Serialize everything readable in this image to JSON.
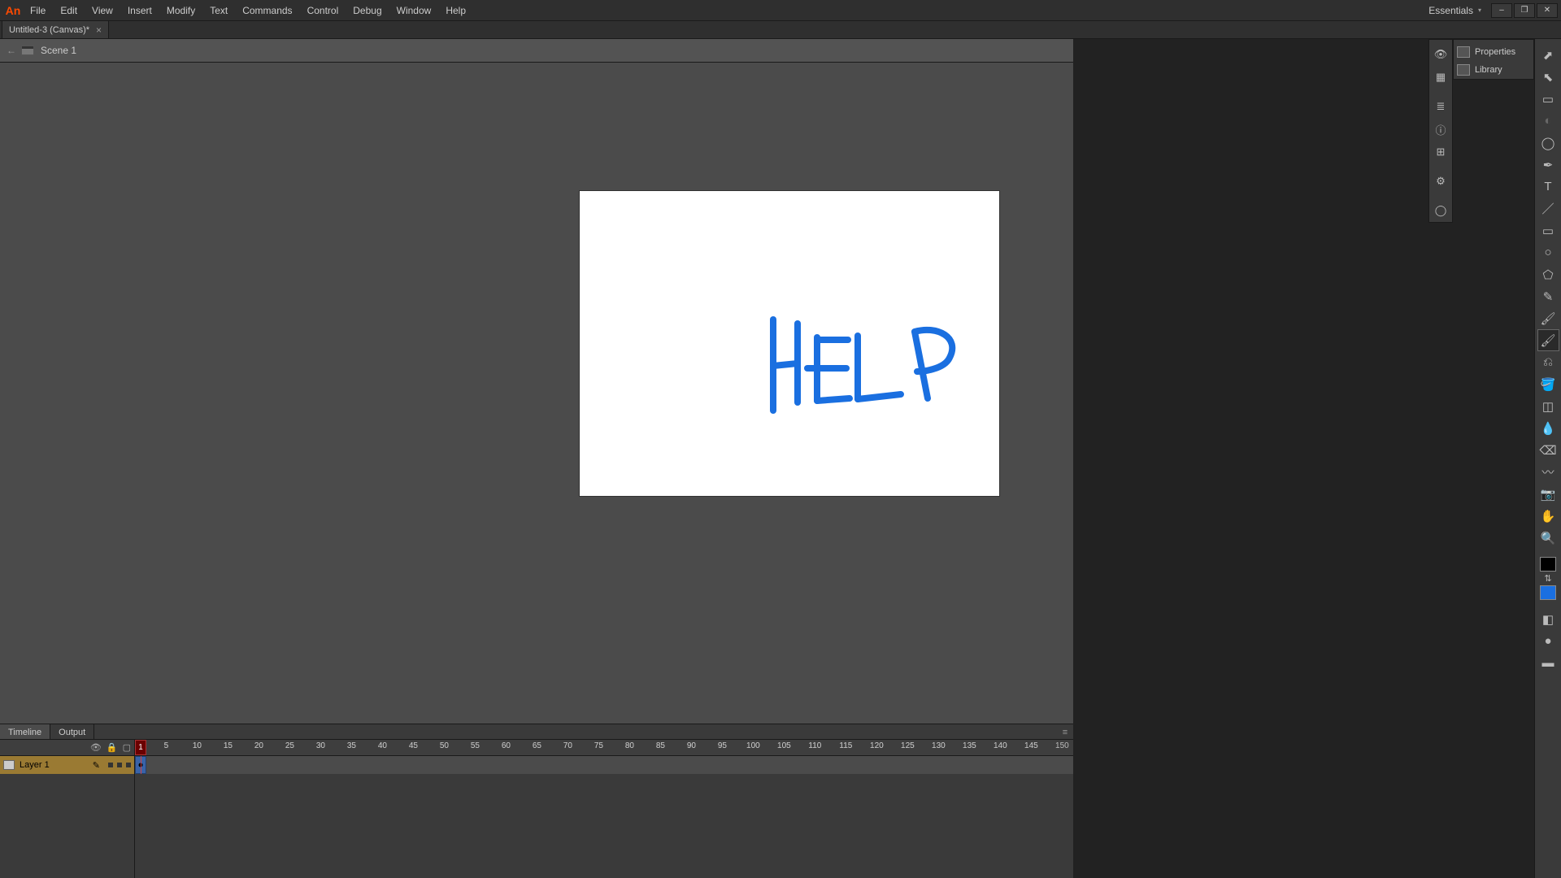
{
  "app": {
    "logo": "An"
  },
  "menus": [
    "File",
    "Edit",
    "View",
    "Insert",
    "Modify",
    "Text",
    "Commands",
    "Control",
    "Debug",
    "Window",
    "Help"
  ],
  "workspace": "Essentials",
  "window_controls": {
    "minimize": "–",
    "maximize": "❐",
    "close": "✕"
  },
  "doc_tab": {
    "title": "Untitled-3 (Canvas)*",
    "close": "×"
  },
  "scene": {
    "name": "Scene 1",
    "back": "←"
  },
  "iconcol": [
    "👁",
    "▦",
    "—",
    "≣",
    "ⓘ",
    "⊞",
    "—",
    "⚙",
    "—",
    "◯"
  ],
  "rightpanel": {
    "properties": "Properties",
    "library": "Library"
  },
  "tools": [
    {
      "id": "selection-tool",
      "g": "⬈",
      "sel": false
    },
    {
      "id": "subselection-tool",
      "g": "⬉",
      "sel": false
    },
    {
      "id": "free-transform",
      "g": "▭",
      "sel": false
    },
    {
      "id": "3d-rotation",
      "g": "◐",
      "sel": false,
      "dis": true
    },
    {
      "id": "lasso-tool",
      "g": "◯",
      "sel": false
    },
    {
      "id": "pen-tool",
      "g": "✒",
      "sel": false
    },
    {
      "id": "text-tool",
      "g": "T",
      "sel": false
    },
    {
      "id": "line-tool",
      "g": "／",
      "sel": false
    },
    {
      "id": "rectangle-tool",
      "g": "▭",
      "sel": false
    },
    {
      "id": "oval-tool",
      "g": "○",
      "sel": false
    },
    {
      "id": "polystar-tool",
      "g": "⬠",
      "sel": false
    },
    {
      "id": "pencil-tool",
      "g": "✎",
      "sel": false
    },
    {
      "id": "brush-tool",
      "g": "🖌",
      "sel": false
    },
    {
      "id": "paint-brush-tool",
      "g": "🖌",
      "sel": true
    },
    {
      "id": "bone-tool",
      "g": "⎌",
      "sel": false
    },
    {
      "id": "paint-bucket-tool",
      "g": "🪣",
      "sel": false
    },
    {
      "id": "ink-bottle-tool",
      "g": "◫",
      "sel": false
    },
    {
      "id": "eyedropper-tool",
      "g": "💧",
      "sel": false
    },
    {
      "id": "eraser-tool",
      "g": "⌫",
      "sel": false
    },
    {
      "id": "width-tool",
      "g": "〰",
      "sel": false
    },
    {
      "id": "camera-tool",
      "g": "📷",
      "sel": false
    },
    {
      "id": "hand-tool",
      "g": "✋",
      "sel": false
    },
    {
      "id": "zoom-tool",
      "g": "🔍",
      "sel": false
    }
  ],
  "swatches": {
    "stroke": "#000000",
    "fill": "#1a6fe0"
  },
  "bottom_tabs": {
    "timeline": "Timeline",
    "output": "Output"
  },
  "ruler": {
    "start": 1,
    "step": 5,
    "count": 30
  },
  "playhead_frame": "1",
  "layer": {
    "name": "Layer 1"
  },
  "canvas_text": "HELP",
  "canvas_stroke": "#1a6fe0"
}
